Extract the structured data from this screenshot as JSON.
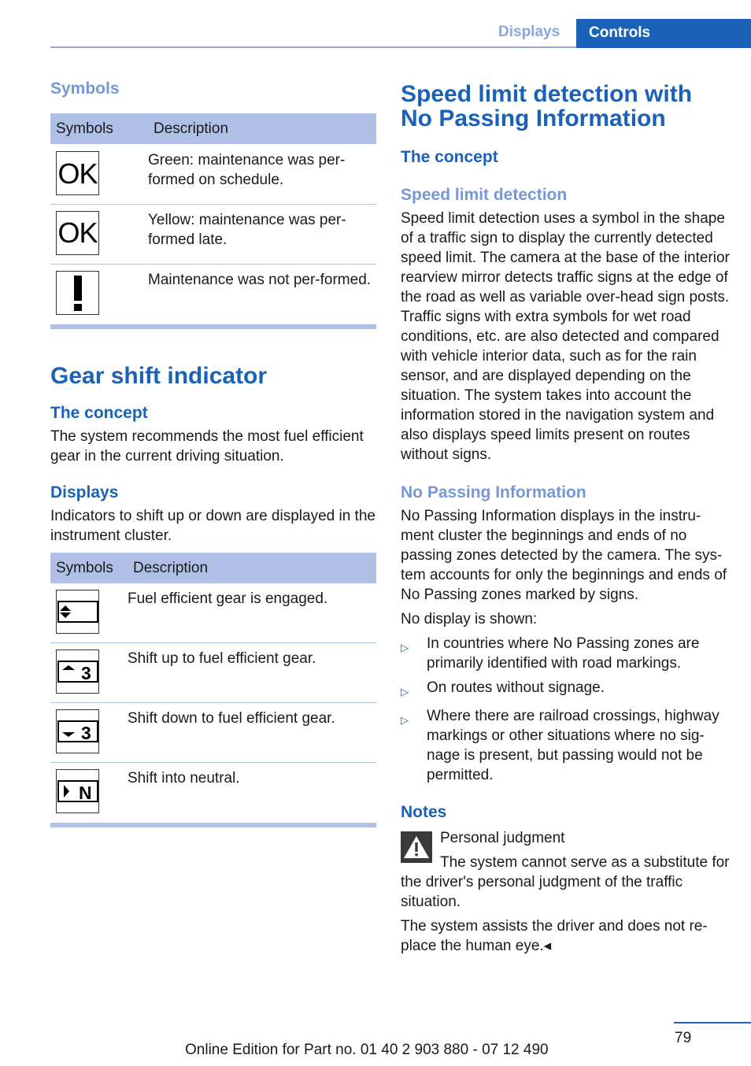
{
  "header": {
    "tabs": [
      {
        "label": "Displays",
        "active": false
      },
      {
        "label": "Controls",
        "active": true
      }
    ]
  },
  "left": {
    "symbols_section": {
      "heading": "Symbols",
      "table": {
        "headers": [
          "Symbols",
          "Description"
        ],
        "rows": [
          {
            "icon": "ok-green-icon",
            "icon_text": "OK",
            "description": "Green: maintenance was per-formed on schedule."
          },
          {
            "icon": "ok-yellow-icon",
            "icon_text": "OK",
            "description": "Yellow: maintenance was per-formed late."
          },
          {
            "icon": "exclamation-icon",
            "icon_text": "!",
            "description": "Maintenance was not per-formed."
          }
        ]
      }
    },
    "gear_shift": {
      "title": "Gear shift indicator",
      "concept_heading": "The concept",
      "concept_text": "The system recommends the most fuel efficient gear in the current driving situation.",
      "displays_heading": "Displays",
      "displays_text": "Indicators to shift up or down are displayed in the instrument cluster.",
      "table": {
        "headers": [
          "Symbols",
          "Description"
        ],
        "rows": [
          {
            "icon": "gear-engaged-icon",
            "icon_text": "",
            "description": "Fuel efficient gear is engaged."
          },
          {
            "icon": "shift-up-icon",
            "icon_text": "3",
            "description": "Shift up to fuel efficient gear."
          },
          {
            "icon": "shift-down-icon",
            "icon_text": "3",
            "description": "Shift down to fuel efficient gear."
          },
          {
            "icon": "shift-neutral-icon",
            "icon_text": "N",
            "description": "Shift into neutral."
          }
        ]
      }
    }
  },
  "right": {
    "title": "Speed limit detection with No Passing Information",
    "concept_heading": "The concept",
    "speed_limit_heading": "Speed limit detection",
    "speed_limit_text": "Speed limit detection uses a symbol in the shape of a traffic sign to display the currently detected speed limit. The camera at the base of the interior rearview mirror detects traffic signs at the edge of the road as well as variable over-head sign posts. Traffic signs with extra symbols for wet road conditions, etc. are also detected and compared with vehicle interior data, such as for the rain sensor, and are displayed depending on the situation. The system takes into account the information stored in the navigation system and also displays speed limits present on routes without signs.",
    "no_passing_heading": "No Passing Information",
    "no_passing_text": "No Passing Information displays in the instru-ment cluster the beginnings and ends of no passing zones detected by the camera. The sys-tem accounts for only the beginnings and ends of No Passing zones marked by signs.",
    "no_display_intro": "No display is shown:",
    "no_display_list": [
      "In countries where No Passing zones are primarily identified with road markings.",
      "On routes without signage.",
      "Where there are railroad crossings, highway markings or other situations where no sig-nage is present, but passing would not be permitted."
    ],
    "notes_heading": "Notes",
    "warning_title": "Personal judgment",
    "warning_text": "The system cannot serve as a substitute for the driver's personal judgment of the traffic situation.",
    "final_text": "The system assists the driver and does not re-place the human eye.◂"
  },
  "footer": {
    "page_number": "79",
    "edition_text": "Online Edition for Part no. 01 40 2 903 880 - 07 12 490"
  }
}
